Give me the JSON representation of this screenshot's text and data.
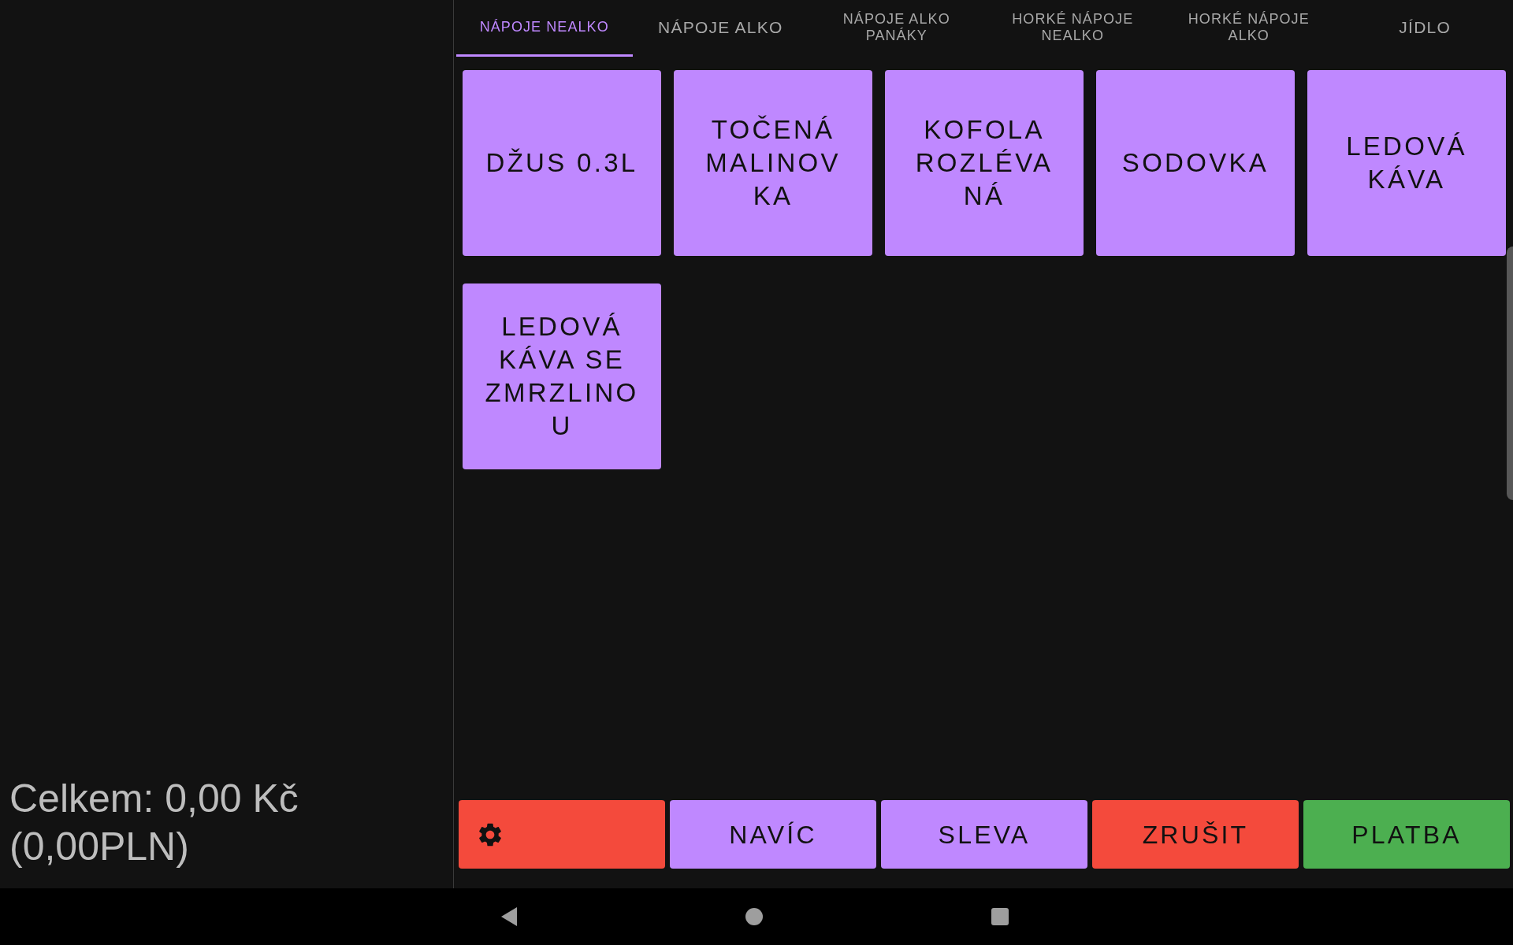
{
  "categories": [
    {
      "label": "NÁPOJE NEALKO",
      "selected": true
    },
    {
      "label": "NÁPOJE ALKO",
      "selected": false
    },
    {
      "label": "NÁPOJE ALKO PANÁKY",
      "selected": false
    },
    {
      "label": "HORKÉ NÁPOJE NEALKO",
      "selected": false
    },
    {
      "label": "HORKÉ NÁPOJE ALKO",
      "selected": false
    },
    {
      "label": "JÍDLO",
      "selected": false
    }
  ],
  "products": [
    {
      "label": "DŽUS 0.3L"
    },
    {
      "label": "TOČENÁ MALINOVKA"
    },
    {
      "label": "KOFOLA ROZLÉVANÁ"
    },
    {
      "label": "SODOVKA"
    },
    {
      "label": "LEDOVÁ KÁVA"
    },
    {
      "label": "LEDOVÁ KÁVA SE ZMRZLINOU"
    }
  ],
  "total": "Celkem: 0,00 Kč (0,00PLN)",
  "actions": [
    {
      "kind": "settings",
      "color": "#f44a3c"
    },
    {
      "kind": "label",
      "label": "NAVÍC",
      "color": "#bf88ff"
    },
    {
      "kind": "label",
      "label": "SLEVA",
      "color": "#bf88ff"
    },
    {
      "kind": "label",
      "label": "ZRUŠIT",
      "color": "#f44a3c"
    },
    {
      "kind": "label",
      "label": "PLATBA",
      "color": "#4caf50"
    }
  ]
}
